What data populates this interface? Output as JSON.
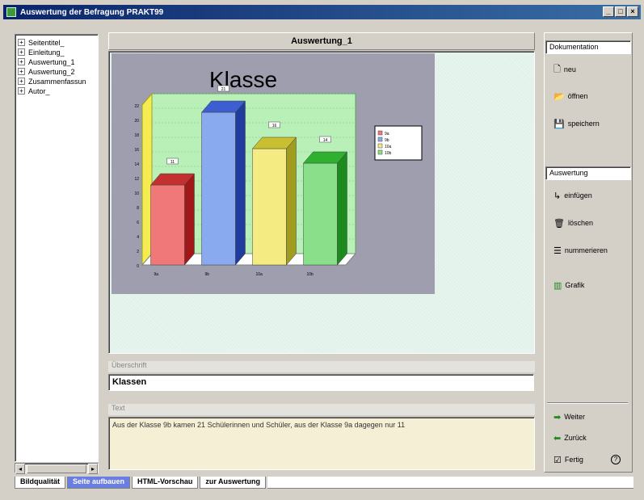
{
  "window": {
    "title": "Auswertung der Befragung PRAKT99",
    "buttons": [
      "_",
      "□",
      "×"
    ]
  },
  "tree": {
    "items": [
      {
        "label": "Seitentitel_",
        "expander": "+"
      },
      {
        "label": "Einleitung_",
        "expander": "+"
      },
      {
        "label": "Auswertung_1",
        "expander": "+"
      },
      {
        "label": "Auswertung_2",
        "expander": "+"
      },
      {
        "label": "Zusammenfassun",
        "expander": "+"
      },
      {
        "label": "Autor_",
        "expander": "+"
      }
    ],
    "scroll_left": "◂",
    "scroll_right": "▸"
  },
  "page": {
    "title": "Auswertung_1",
    "heading_label": "Überschrift",
    "heading_value": "Klassen",
    "text_label": "Text",
    "text_value": "Aus der Klasse 9b kamen 21 Schülerinnen und Schüler, aus der Klasse 9a dagegen nur 11"
  },
  "chart_data": {
    "type": "bar",
    "title": "Klasse",
    "categories": [
      "9a",
      "9b",
      "10a",
      "10b"
    ],
    "values": [
      11,
      21,
      16,
      14
    ],
    "data_labels": [
      "11",
      "21",
      "16",
      "14"
    ],
    "colors": [
      "#f07878",
      "#8aaaf0",
      "#f4ec82",
      "#8ae08a"
    ],
    "side_colors": [
      "#a01818",
      "#203c9c",
      "#a09c20",
      "#1c8a1c"
    ],
    "top_colors": [
      "#c43030",
      "#3c5ed0",
      "#c8c030",
      "#30b030"
    ],
    "legend": [
      "9a",
      "9b",
      "10a",
      "10b"
    ],
    "legend_position": "right",
    "y_ticks": [
      "0",
      "2",
      "4",
      "6",
      "8",
      "10",
      "12",
      "14",
      "16",
      "18",
      "20",
      "22"
    ],
    "ylim": [
      0,
      22
    ],
    "grid": true
  },
  "right_panel": {
    "dokumentation": {
      "label": "Dokumentation",
      "buttons": [
        {
          "label": "neu",
          "icon": "new-file-icon",
          "glyph": "🗋"
        },
        {
          "label": "öffnen",
          "icon": "open-folder-icon",
          "glyph": "📂"
        },
        {
          "label": "speichern",
          "icon": "save-disk-icon",
          "glyph": "💾"
        }
      ]
    },
    "auswertung": {
      "label": "Auswertung",
      "buttons": [
        {
          "label": "einfügen",
          "icon": "insert-icon",
          "glyph": "↳"
        },
        {
          "label": "löschen",
          "icon": "trash-icon",
          "glyph": "🗑"
        },
        {
          "label": "nummerieren",
          "icon": "numbered-list-icon",
          "glyph": "☰"
        },
        {
          "label": "Grafik",
          "icon": "bar-chart-icon",
          "glyph": "▥"
        }
      ]
    },
    "nav": {
      "weiter": "Weiter",
      "zurueck": "Zurück",
      "fertig": "Fertig",
      "help": "?"
    }
  },
  "tabs": [
    {
      "label": "Bildqualität",
      "active": false
    },
    {
      "label": "Seite aufbauen",
      "active": true
    },
    {
      "label": "HTML-Vorschau",
      "active": false
    },
    {
      "label": "zur Auswertung",
      "active": false
    }
  ]
}
